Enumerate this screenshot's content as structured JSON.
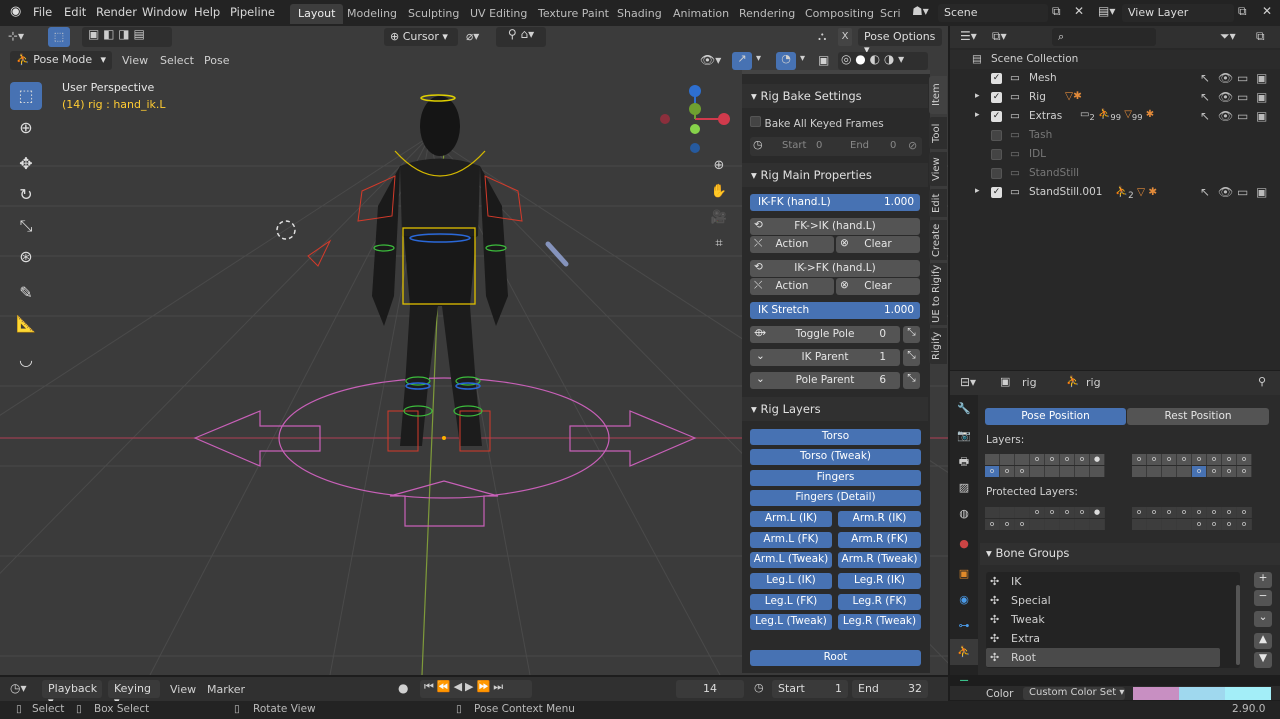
{
  "topbar": {
    "menus": [
      "File",
      "Edit",
      "Render",
      "Window",
      "Help",
      "Pipeline"
    ],
    "workspaces": [
      "Layout",
      "Modeling",
      "Sculpting",
      "UV Editing",
      "Texture Paint",
      "Shading",
      "Animation",
      "Rendering",
      "Compositing",
      "Scri"
    ],
    "scene": "Scene",
    "view_layer": "View Layer"
  },
  "viewport": {
    "header_row1": {
      "cursor_label": "Cursor",
      "pose_options": "Pose Options"
    },
    "header_row2": {
      "mode": "Pose Mode",
      "menus": [
        "View",
        "Select",
        "Pose"
      ]
    },
    "info_title": "User Perspective",
    "info_sub": "(14) rig : hand_ik.L"
  },
  "npanel": {
    "tabs": [
      "Item",
      "Tool",
      "View",
      "Edit",
      "Create",
      "UE to Rigify",
      "Rigify"
    ],
    "rig_bake": {
      "title": "Rig Bake Settings",
      "bake_all": "Bake All Keyed Frames",
      "start_label": "Start",
      "start_val": "0",
      "end_label": "End",
      "end_val": "0"
    },
    "rig_main": {
      "title": "Rig Main Properties",
      "ikfk_label": "IK-FK (hand.L)",
      "ikfk_val": "1.000",
      "fk_ik": "FK->IK (hand.L)",
      "ik_fk": "IK->FK (hand.L)",
      "action": "Action",
      "clear": "Clear",
      "ik_stretch_label": "IK Stretch",
      "ik_stretch_val": "1.000",
      "toggle_pole": "Toggle Pole",
      "toggle_pole_val": "0",
      "ik_parent": "IK Parent",
      "ik_parent_val": "1",
      "pole_parent": "Pole Parent",
      "pole_parent_val": "6"
    },
    "rig_layers": {
      "title": "Rig Layers",
      "full": [
        "Torso",
        "Torso (Tweak)",
        "Fingers",
        "Fingers (Detail)"
      ],
      "pairs": [
        [
          "Arm.L (IK)",
          "Arm.R (IK)"
        ],
        [
          "Arm.L (FK)",
          "Arm.R (FK)"
        ],
        [
          "Arm.L (Tweak)",
          "Arm.R (Tweak)"
        ],
        [
          "Leg.L (IK)",
          "Leg.R (IK)"
        ],
        [
          "Leg.L (FK)",
          "Leg.R (FK)"
        ],
        [
          "Leg.L (Tweak)",
          "Leg.R (Tweak)"
        ]
      ],
      "root": "Root"
    }
  },
  "outliner": {
    "items": [
      {
        "name": "Scene Collection",
        "indent": 0,
        "checkbox": null,
        "enabled": true
      },
      {
        "name": "Mesh",
        "indent": 1,
        "checkbox": true,
        "enabled": true
      },
      {
        "name": "Rig",
        "indent": 1,
        "checkbox": true,
        "enabled": true
      },
      {
        "name": "Extras",
        "indent": 1,
        "checkbox": true,
        "enabled": true
      },
      {
        "name": "Tash",
        "indent": 1,
        "checkbox": false,
        "enabled": false
      },
      {
        "name": "IDL",
        "indent": 1,
        "checkbox": false,
        "enabled": false
      },
      {
        "name": "StandStill",
        "indent": 1,
        "checkbox": false,
        "enabled": false
      },
      {
        "name": "StandStill.001",
        "indent": 1,
        "checkbox": true,
        "enabled": true
      }
    ],
    "extras_counts": [
      "2",
      "99",
      "99"
    ],
    "standstill_count": "2"
  },
  "properties": {
    "object": "rig",
    "data": "rig",
    "pose_position": "Pose Position",
    "rest_position": "Rest Position",
    "layers_label": "Layers:",
    "protected_label": "Protected Layers:",
    "bone_groups_title": "Bone Groups",
    "bone_groups": [
      "IK",
      "Special",
      "Tweak",
      "Extra",
      "Root"
    ],
    "color_label": "Color",
    "color_set": "Custom Color Set",
    "swatches": [
      "#c88fc2",
      "#9fd8ee",
      "#a3eef8"
    ]
  },
  "timeline": {
    "menus": [
      "Playback",
      "Keying",
      "View",
      "Marker"
    ],
    "frame": "14",
    "start_label": "Start",
    "start": "1",
    "end_label": "End",
    "end": "32"
  },
  "statusbar": {
    "items": [
      "Select",
      "Box Select",
      "Rotate View",
      "Pose Context Menu"
    ],
    "version": "2.90.0"
  }
}
